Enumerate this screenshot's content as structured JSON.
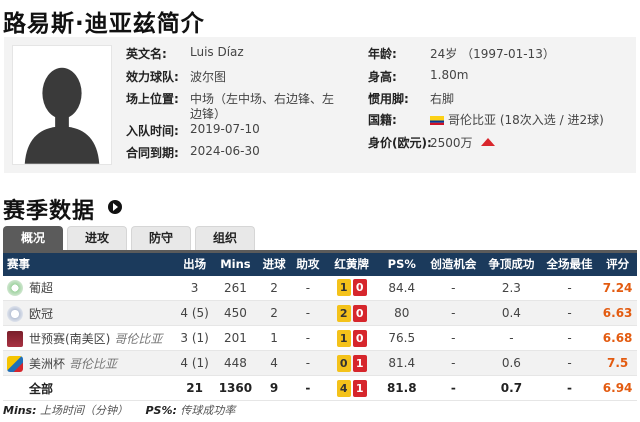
{
  "page_title": "路易斯·迪亚兹简介",
  "profile": {
    "english_name_label": "英文名:",
    "english_name": "Luis Díaz",
    "club_label": "效力球队:",
    "club": "波尔图",
    "position_label": "场上位置:",
    "position_line1": "中场（左中场、右边锋、左",
    "position_line2": "边锋）",
    "join_date_label": "入队时间:",
    "join_date": "2019-07-10",
    "contract_label": "合同到期:",
    "contract": "2024-06-30",
    "age_label": "年龄:",
    "age": "24岁 （1997-01-13）",
    "height_label": "身高:",
    "height": "1.80m",
    "foot_label": "惯用脚:",
    "foot": "右脚",
    "nationality_label": "国籍:",
    "nationality": "哥伦比亚 (18次入选 / 进2球)",
    "value_label": "身价(欧元):",
    "value": "2500万"
  },
  "season_title": "赛季数据",
  "tabs": [
    "概况",
    "进攻",
    "防守",
    "组织"
  ],
  "table": {
    "headers": [
      "赛事",
      "出场",
      "Mins",
      "进球",
      "助攻",
      "红黄牌",
      "PS%",
      "创造机会",
      "争顶成功",
      "全场最佳",
      "评分"
    ],
    "rows": [
      {
        "comp": "葡超",
        "note": "",
        "apps": "3",
        "mins": "261",
        "goals": "2",
        "assists": "-",
        "yellow": "1",
        "red": "0",
        "ps": "84.4",
        "chances": "-",
        "aerial": "2.3",
        "motm": "-",
        "rating": "7.24"
      },
      {
        "comp": "欧冠",
        "note": "",
        "apps": "4 (5)",
        "mins": "450",
        "goals": "2",
        "assists": "-",
        "yellow": "2",
        "red": "0",
        "ps": "80",
        "chances": "-",
        "aerial": "0.4",
        "motm": "-",
        "rating": "6.63"
      },
      {
        "comp": "世预赛(南美区)",
        "note": "哥伦比亚",
        "apps": "3 (1)",
        "mins": "201",
        "goals": "1",
        "assists": "-",
        "yellow": "1",
        "red": "0",
        "ps": "76.5",
        "chances": "-",
        "aerial": "-",
        "motm": "-",
        "rating": "6.68"
      },
      {
        "comp": "美洲杯",
        "note": "哥伦比亚",
        "apps": "4 (1)",
        "mins": "448",
        "goals": "4",
        "assists": "-",
        "yellow": "0",
        "red": "1",
        "ps": "81.4",
        "chances": "-",
        "aerial": "0.6",
        "motm": "-",
        "rating": "7.5"
      }
    ],
    "total": {
      "comp": "全部",
      "apps": "21",
      "mins": "1360",
      "goals": "9",
      "assists": "-",
      "yellow": "4",
      "red": "1",
      "ps": "81.8",
      "chances": "-",
      "aerial": "0.7",
      "motm": "-",
      "rating": "6.94"
    }
  },
  "footnote": {
    "mins_key": "Mins:",
    "mins_desc": "上场时间（分钟）",
    "ps_key": "PS%:",
    "ps_desc": "传球成功率"
  },
  "colors": {
    "header_bg": "#1b3a5c",
    "rating": "#e35b10",
    "yellow_card": "#f4c21a",
    "red_card": "#d6262c",
    "value_arrow": "#d9262c"
  },
  "icons": {
    "comp_icons": [
      "liga-portugal-icon",
      "champions-league-icon",
      "world-cup-qualifier-icon",
      "copa-america-icon"
    ]
  }
}
